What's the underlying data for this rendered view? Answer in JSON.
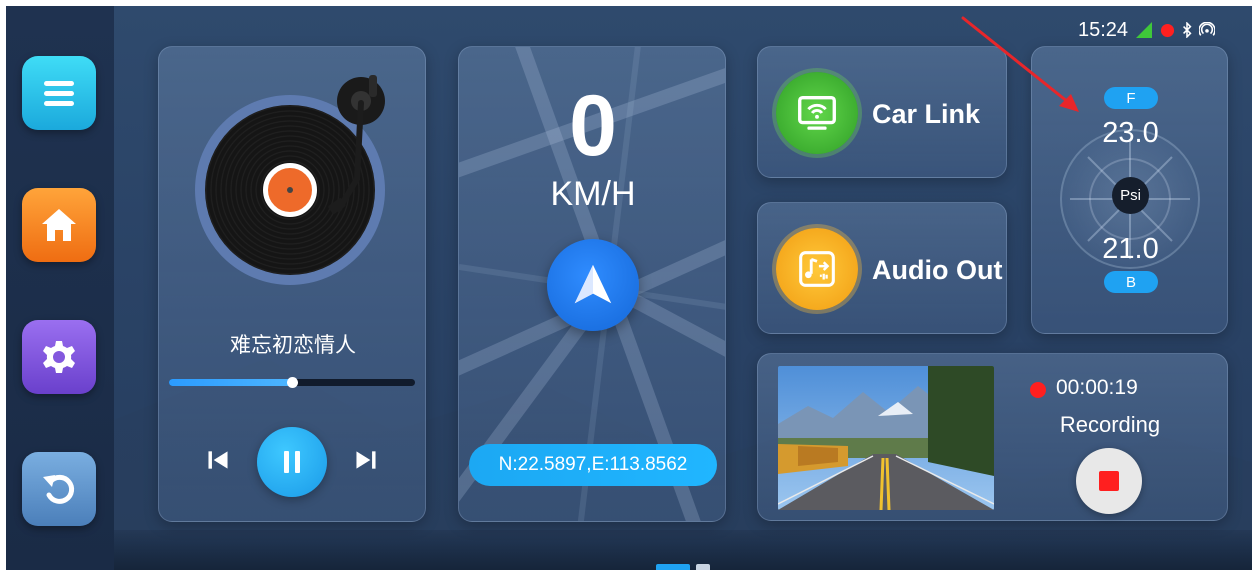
{
  "status_bar": {
    "time": "15:24",
    "icons": [
      "signal-icon",
      "record-dot-icon",
      "bluetooth-icon",
      "wifi-hotspot-icon"
    ]
  },
  "sidebar": {
    "items": [
      {
        "name": "menu",
        "icon": "menu-icon",
        "color": "#28c6e8"
      },
      {
        "name": "home",
        "icon": "home-icon",
        "color": "#f47a1c"
      },
      {
        "name": "settings",
        "icon": "gear-icon",
        "color": "#7b54d8"
      },
      {
        "name": "back",
        "icon": "back-icon",
        "color": "#5b8ec6"
      }
    ]
  },
  "music": {
    "song_title": "难忘初恋情人",
    "progress": 0.5,
    "icons": [
      "vinyl-record-icon",
      "prev-icon",
      "pause-icon",
      "next-icon"
    ]
  },
  "navigation": {
    "speed": "0",
    "unit": "KM/H",
    "coordinates": "N:22.5897,E:113.8562",
    "icon": "navigation-arrow-icon"
  },
  "apps": {
    "car_link": {
      "label": "Car Link",
      "icon": "car-link-icon",
      "color": "#4cc03a"
    },
    "audio_out": {
      "label": "Audio Out",
      "icon": "audio-out-icon",
      "color": "#f6ae1c"
    }
  },
  "tire_pressure": {
    "front_label": "F",
    "front_value": "23.0",
    "unit": "Psi",
    "back_value": "21.0",
    "back_label": "B"
  },
  "recording": {
    "time": "00:00:19",
    "status": "Recording",
    "icons": [
      "record-dot-icon",
      "stop-icon"
    ]
  },
  "colors": {
    "accent_blue": "#1fa2f2",
    "record_red": "#ff1f1f",
    "annotation_red": "#e8262a"
  }
}
